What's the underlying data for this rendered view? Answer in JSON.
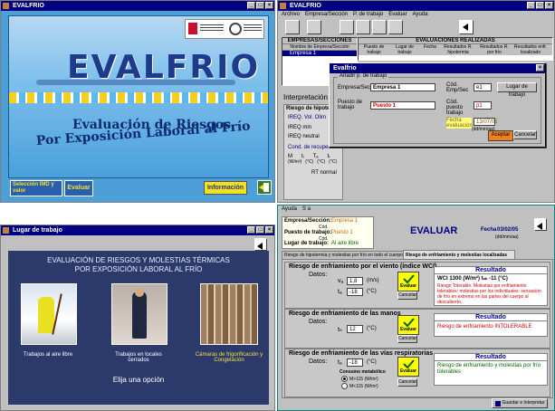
{
  "win1": {
    "title": "EVALFRIO",
    "logo_text": "EVALFRIO",
    "subtitle_line1": "Evaluación de Riesgos",
    "subtitle_line2": "Por Exposición Laboral al Frío",
    "btn_selection": "Selección IMD y valor",
    "btn_evaluar": "Evaluar",
    "btn_info": "Información"
  },
  "win2": {
    "title": "EVALFRIO",
    "menu": [
      "Archivo",
      "Empresa/Sección",
      "P. de trabajo",
      "Evaluar",
      "Ayuda"
    ],
    "left_header": "EMPRESAS/SECCIONES",
    "left_col1": "Nombre de Empresa/Sección",
    "left_row1": "Empresa 1",
    "right_header": "EVALUACIONES REALIZADAS",
    "cols": [
      "Puesto de trabajo",
      "Lugar de trabajo",
      "Fecha",
      "Resultados R. hipotermia",
      "Resultados R. por frío",
      "Resultados enfr. localizado"
    ],
    "interp_label": "Interpretación de",
    "riesgo_hip": "Riesgo de hipote",
    "ireq_label": "IREQ. Vol. Olim",
    "ireq_min": "IREQ min",
    "ireq_neutral": "IREQ neutral",
    "cond_label": "Cond. de recuperación a RT",
    "formula_labels": [
      "M",
      "tᵢ",
      "Tₐ",
      "tᵣ"
    ],
    "formula_units": [
      "(W/m²)",
      "(°C)",
      "(°C)",
      "(°C)"
    ],
    "rt_label": "RT normal",
    "dialog": {
      "title": "Evalfrio",
      "group": "Añadir p. de trabajo",
      "empresa_label": "Empresa/Sección",
      "empresa_value": "Empresa 1",
      "puesto_label": "Puesto de trabajo",
      "puesto_value": "Puesto 1",
      "cod_emp_label": "Cód. Emp/Sec",
      "cod_emp_value": "e1",
      "cod_puesto_label": "Cód. puesto trabajo",
      "cod_puesto_value": "p1",
      "fecha_label": "Fecha evaluación",
      "fecha_value": "13/07/05",
      "fecha_hint": "(dd/mm/aa)",
      "lugar_btn": "Lugar de trabajo",
      "aceptar": "Aceptar",
      "cancelar": "Cancelar"
    }
  },
  "win3": {
    "title": "Lugar de trabajo",
    "heading1": "EVALUACIÓN DE RIESGOS Y MOLESTIAS TÉRMICAS",
    "heading2": "POR EXPOSICIÓN LABORAL AL FRÍO",
    "opt1": "Trabajos al aire libre",
    "opt2": "Trabajos en locales cerrados",
    "opt3": "Cámaras de frigorificación y Congelación",
    "prompt": "Elija una opción"
  },
  "win4": {
    "menu": [
      "Ayuda",
      "S a"
    ],
    "empresa_label": "Empresa/Sección:",
    "empresa_value": "Empresa 1",
    "cod_label1": "Cód.",
    "puesto_label": "Puesto de trabajo:",
    "puesto_value": "Puesto 1",
    "cod_label2": "Cód.",
    "lugar_label": "Lugar de trabajo:",
    "lugar_value": "Al aire libre",
    "title": "EVALUAR",
    "fecha_label": "Fecha",
    "fecha_value": "03/02/05",
    "fecha_hint": "(dd/mm/aa)",
    "tab1": "Riesgo de hipotermia y molestias por frío en todo el cuerpo",
    "tab2": "Riesgo de enfriamiento y molestias localizadas",
    "s1": {
      "heading": "Riesgo de enfriamiento por el viento (índice WCI)",
      "datos": "Datos:",
      "va_label": "vₐ",
      "va_value": "1,8",
      "va_unit": "(m/s)",
      "ta_label": "tₐ",
      "ta_value": "-18",
      "ta_unit": "(°C)",
      "btn_eval": "Evaluar",
      "btn_cancel": "Cancelar",
      "res_title": "Resultado",
      "res_line": "WCI 1300 (W/m²)   tₛₖ -11 (°C)",
      "res_text": "Riesgo Tolerable. Molestias por enfriamiento tolerables: molestias por los individuales: sensación de frío en extremo en las partes del cuerpo al descubierto."
    },
    "s2": {
      "heading": "Riesgo de enfriamiento de las manos",
      "datos": "Datos:",
      "t_label": "tₕ",
      "t_value": "12",
      "t_unit": "(°C)",
      "btn_eval": "Evaluar",
      "btn_cancel": "Cancelar",
      "res_title": "Resultado",
      "res_text": "Riesgo de enfriamiento INTOLERABLE"
    },
    "s3": {
      "heading": "Riesgo de enfriamiento de las vías respiratorias",
      "datos": "Datos:",
      "t_label": "tₐ",
      "t_value": "-18",
      "t_unit": "(°C)",
      "consumo_label": "Consumo metabólico",
      "opt1": "M>115 (W/m²)",
      "opt2": "M<115 (W/m²)",
      "btn_eval": "Evaluar",
      "btn_cancel": "Cancelar",
      "res_title": "Resultado",
      "res_text": "Riesgo de enfriamiento y molestias por frío tolerables"
    },
    "save_btn": "Guardar e Interpretar"
  }
}
